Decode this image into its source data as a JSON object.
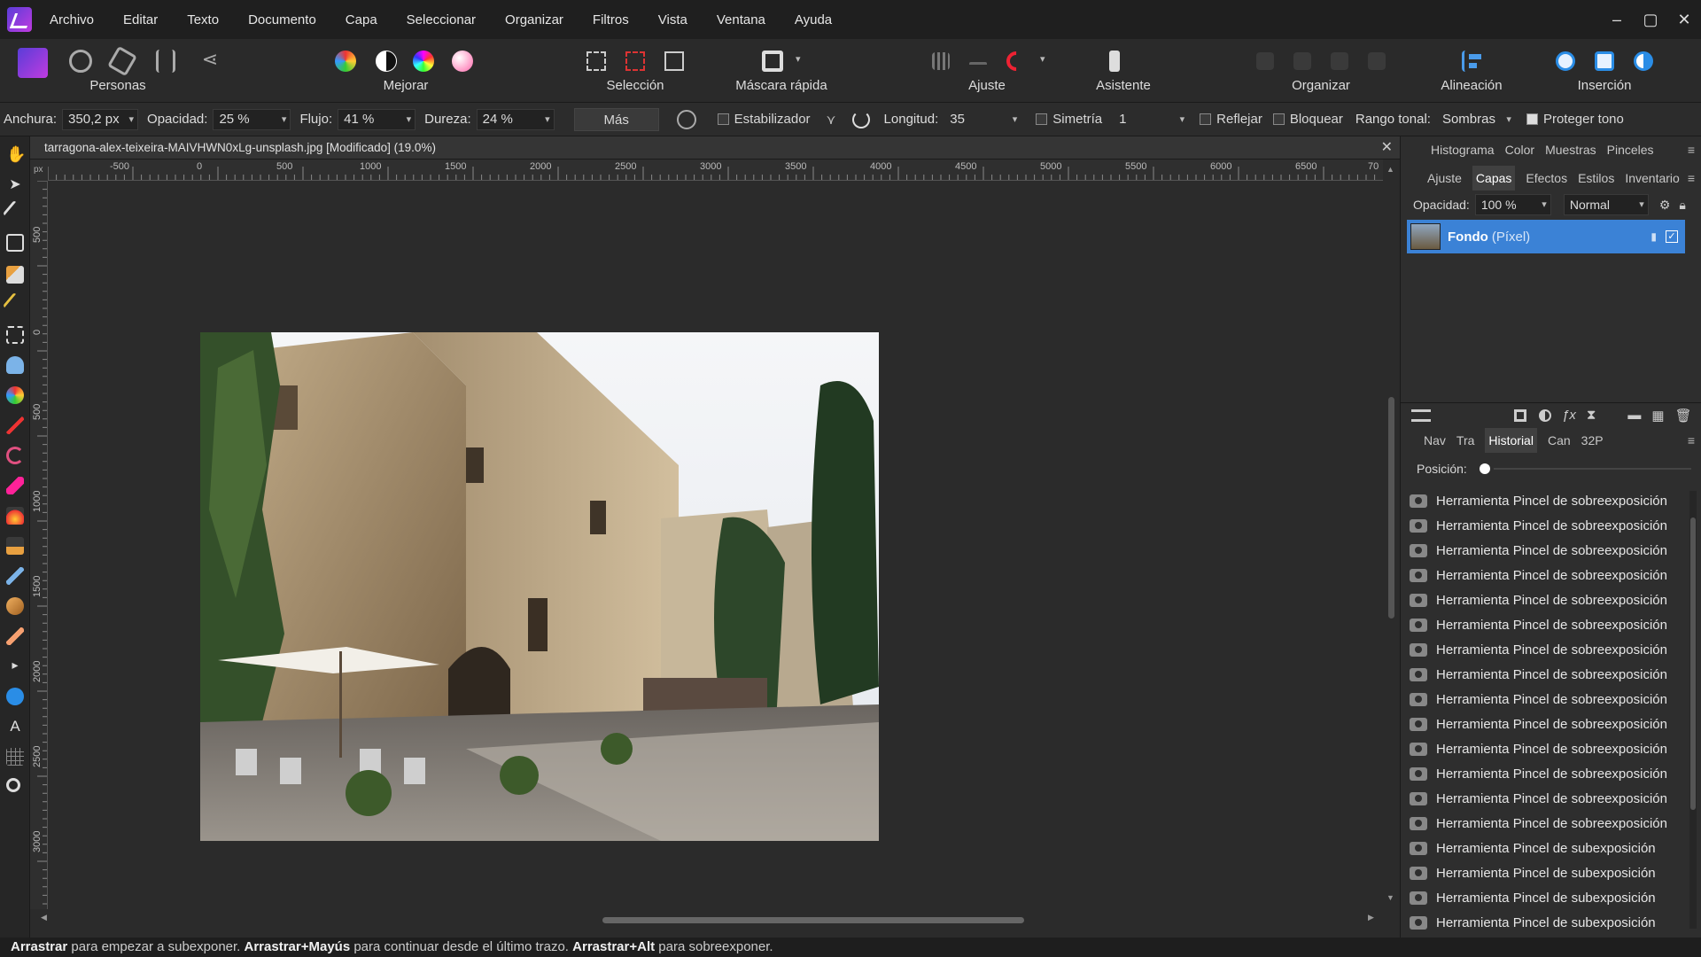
{
  "menu": [
    "Archivo",
    "Editar",
    "Texto",
    "Documento",
    "Capa",
    "Seleccionar",
    "Organizar",
    "Filtros",
    "Vista",
    "Ventana",
    "Ayuda"
  ],
  "toolbar": {
    "groups": [
      "Personas",
      "Mejorar",
      "Selección",
      "Máscara rápida",
      "Ajuste",
      "Asistente",
      "Organizar",
      "Alineación",
      "Inserción"
    ]
  },
  "context": {
    "width_label": "Anchura:",
    "width_value": "350,2 px",
    "opacity_label": "Opacidad:",
    "opacity_value": "25 %",
    "flow_label": "Flujo:",
    "flow_value": "41 %",
    "hardness_label": "Dureza:",
    "hardness_value": "24 %",
    "more_label": "Más",
    "stabilizer_label": "Estabilizador",
    "length_label": "Longitud:",
    "length_value": "35",
    "symmetry_label": "Simetría",
    "symmetry_value": "1",
    "mirror_label": "Reflejar",
    "lock_label": "Bloquear",
    "tonal_label": "Rango tonal:",
    "tonal_value": "Sombras",
    "protect_label": "Proteger tono"
  },
  "document": {
    "title": "tarragona-alex-teixeira-MAIVHWN0xLg-unsplash.jpg [Modificado] (19.0%)",
    "unit": "px"
  },
  "ruler": {
    "h": [
      "-500",
      "0",
      "500",
      "1000",
      "1500",
      "2000",
      "2500",
      "3000",
      "3500",
      "4000",
      "4500",
      "5000",
      "5500",
      "6000",
      "6500",
      "70"
    ],
    "v": [
      "500",
      "0",
      "500",
      "1000",
      "1500",
      "2000",
      "2500",
      "3000"
    ]
  },
  "panel_top": {
    "tabs": [
      "Histograma",
      "Color",
      "Muestras",
      "Pinceles"
    ]
  },
  "panel_mid": {
    "tabs": [
      "Ajuste",
      "Capas",
      "Efectos",
      "Estilos",
      "Inventario"
    ],
    "opacity_label": "Opacidad:",
    "opacity_value": "100 %",
    "blend": "Normal",
    "layer_name": "Fondo",
    "layer_type": "(Píxel)"
  },
  "panel_bottom": {
    "tabs": [
      "Nav",
      "Tra",
      "Historial",
      "Can",
      "32P"
    ],
    "position_label": "Posición:",
    "history": [
      "Herramienta Pincel de sobreexposición",
      "Herramienta Pincel de sobreexposición",
      "Herramienta Pincel de sobreexposición",
      "Herramienta Pincel de sobreexposición",
      "Herramienta Pincel de sobreexposición",
      "Herramienta Pincel de sobreexposición",
      "Herramienta Pincel de sobreexposición",
      "Herramienta Pincel de sobreexposición",
      "Herramienta Pincel de sobreexposición",
      "Herramienta Pincel de sobreexposición",
      "Herramienta Pincel de sobreexposición",
      "Herramienta Pincel de sobreexposición",
      "Herramienta Pincel de sobreexposición",
      "Herramienta Pincel de sobreexposición",
      "Herramienta Pincel de subexposición",
      "Herramienta Pincel de subexposición",
      "Herramienta Pincel de subexposición",
      "Herramienta Pincel de subexposición"
    ]
  },
  "status": {
    "a": "Arrastrar",
    "b": " para empezar a subexponer. ",
    "c": "Arrastrar+Mayús",
    "d": " para continuar desde el último trazo. ",
    "e": "Arrastrar+Alt",
    "f": " para sobreexponer."
  }
}
